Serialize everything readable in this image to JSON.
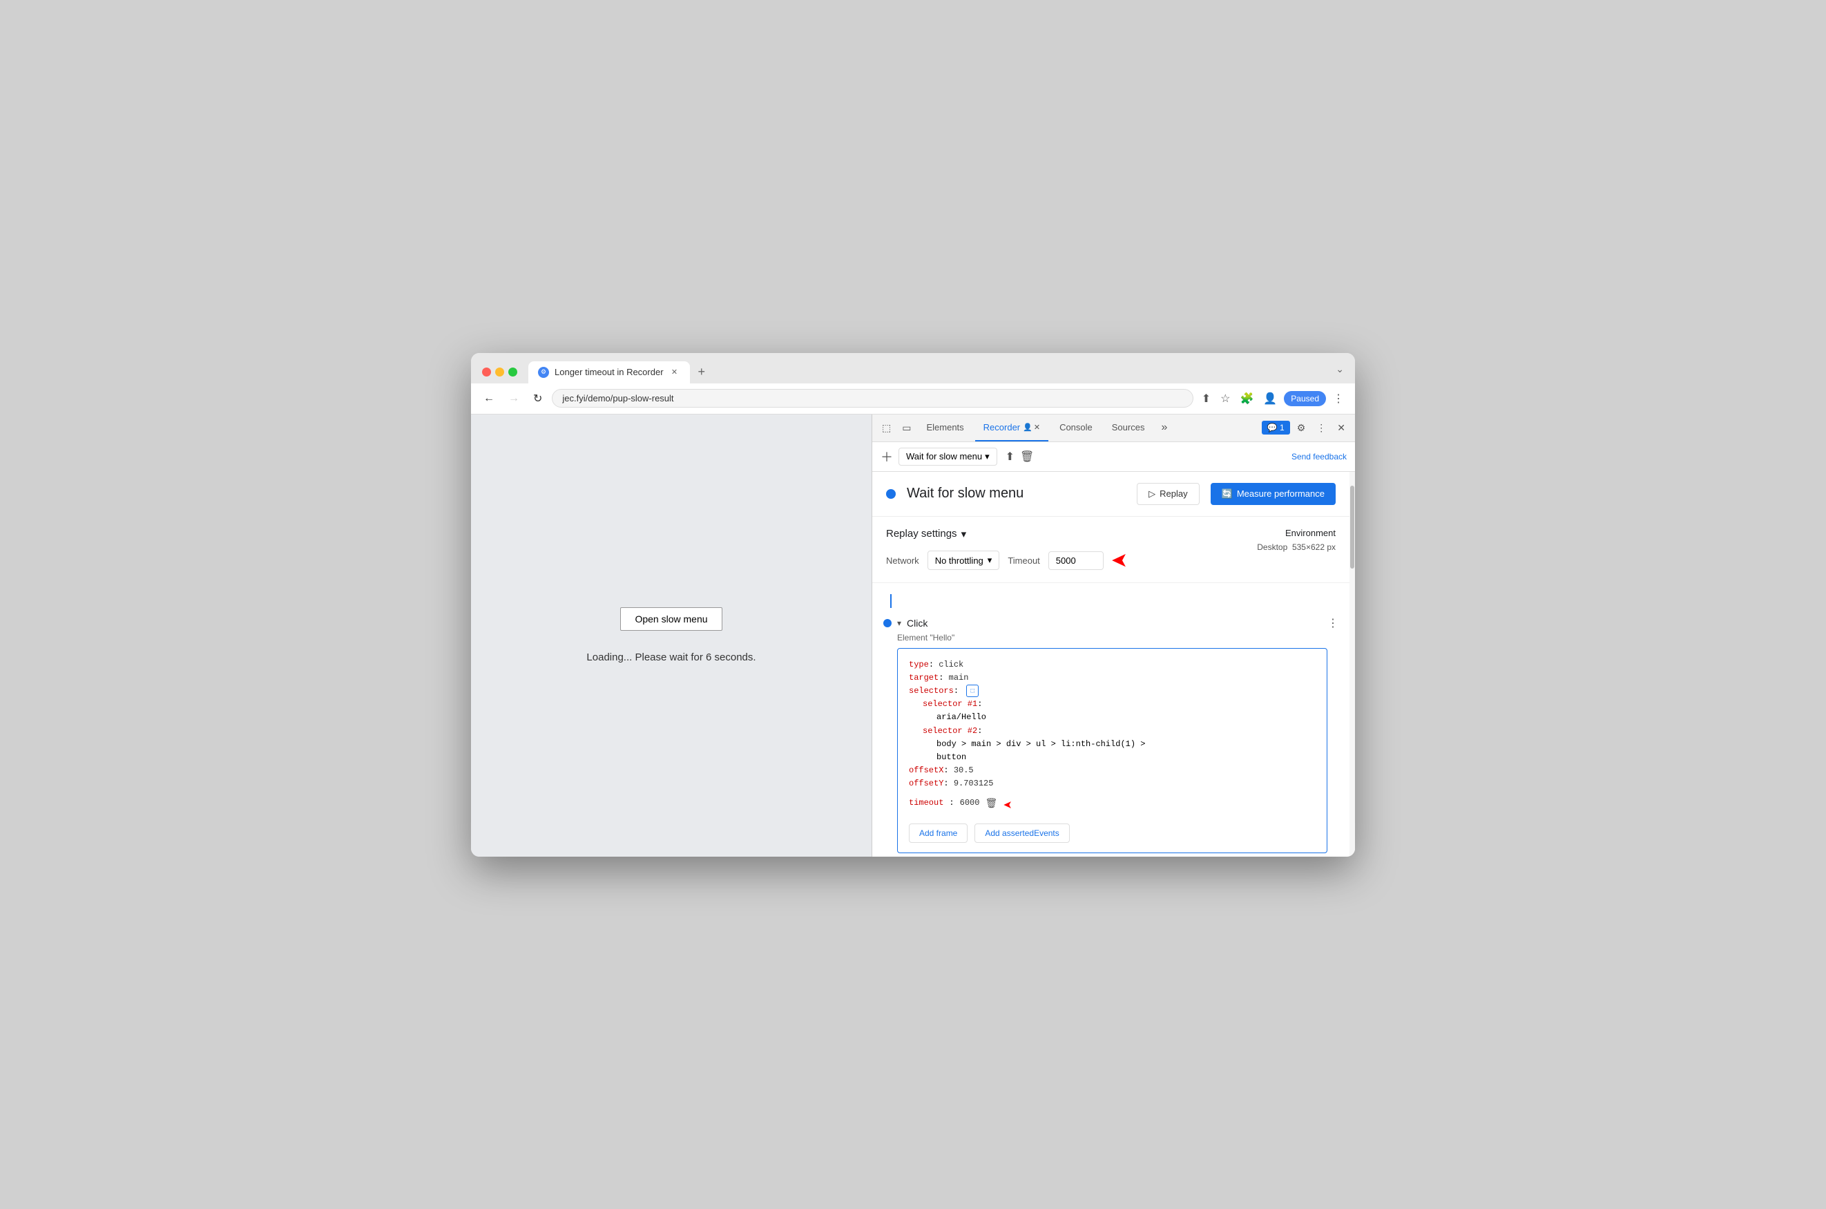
{
  "browser": {
    "tab_title": "Longer timeout in Recorder",
    "url": "jec.fyi/demo/pup-slow-result",
    "paused_label": "Paused",
    "new_tab_label": "+"
  },
  "devtools": {
    "tabs": [
      {
        "id": "elements",
        "label": "Elements"
      },
      {
        "id": "recorder",
        "label": "Recorder",
        "active": true
      },
      {
        "id": "console",
        "label": "Console"
      },
      {
        "id": "sources",
        "label": "Sources"
      }
    ],
    "send_feedback": "Send feedback",
    "recording_name": "Wait for slow menu",
    "replay_btn_label": "Replay",
    "measure_btn_label": "Measure performance",
    "replay_settings_label": "Replay settings",
    "network_label": "Network",
    "network_value": "No throttling",
    "timeout_label": "Timeout",
    "timeout_value": "5000",
    "environment_label": "Environment",
    "environment_value": "Desktop",
    "environment_size": "535×622 px"
  },
  "step": {
    "action": "Click",
    "description": "Element \"Hello\"",
    "more_icon": "⋮",
    "code": {
      "type_key": "type",
      "type_val": "click",
      "target_key": "target",
      "target_val": "main",
      "selectors_key": "selectors",
      "selector1_key": "selector #1",
      "selector1_val": "aria/Hello",
      "selector2_key": "selector #2",
      "selector2_val": "body > main > div > ul > li:nth-child(1) >",
      "selector2_val2": "button",
      "offsetX_key": "offsetX",
      "offsetX_val": "30.5",
      "offsetY_key": "offsetY",
      "offsetY_val": "9.703125",
      "timeout_key": "timeout",
      "timeout_val": "6000"
    },
    "add_frame_btn": "Add frame",
    "add_asserted_btn": "Add assertedEvents"
  },
  "page": {
    "open_menu_btn": "Open slow menu",
    "loading_text": "Loading... Please wait for 6 seconds."
  }
}
